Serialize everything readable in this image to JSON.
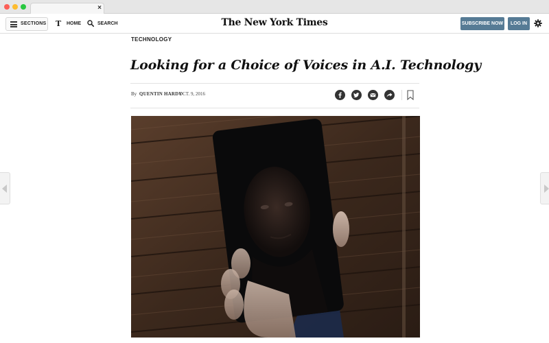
{
  "browser": {
    "tab_close": "×"
  },
  "header": {
    "sections_label": "SECTIONS",
    "home_label": "HOME",
    "search_label": "SEARCH",
    "masthead": "The New York Times",
    "subscribe_label": "SUBSCRIBE NOW",
    "login_label": "LOG IN",
    "t_logo": "T"
  },
  "article": {
    "kicker": "TECHNOLOGY",
    "headline": "Looking for a Choice of Voices in A.I. Technology",
    "byline_prefix": "By",
    "author": "QUENTIN HARDY",
    "date": "OCT. 9, 2016"
  },
  "share": {
    "icons": [
      "facebook-icon",
      "twitter-icon",
      "email-icon",
      "share-icon",
      "bookmark-icon"
    ]
  },
  "colors": {
    "button_blue": "#567b95",
    "share_icon_bg": "#333333"
  }
}
